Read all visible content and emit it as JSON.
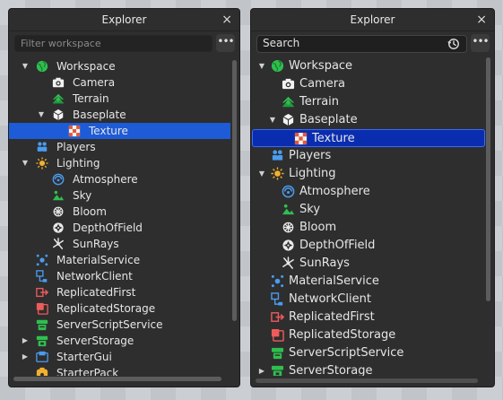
{
  "left_panel": {
    "title": "Explorer",
    "close_glyph": "×",
    "search_placeholder": "Filter workspace",
    "more_glyph": "•••",
    "items": [
      {
        "label": "Workspace",
        "icon": "workspace-globe-icon",
        "arrow": "▼",
        "depth": 0
      },
      {
        "label": "Camera",
        "icon": "camera-icon",
        "arrow": "",
        "depth": 1
      },
      {
        "label": "Terrain",
        "icon": "terrain-icon",
        "arrow": "",
        "depth": 1
      },
      {
        "label": "Baseplate",
        "icon": "part-cube-icon",
        "arrow": "▼",
        "depth": 1
      },
      {
        "label": "Texture",
        "icon": "texture-icon",
        "arrow": "",
        "depth": 2,
        "selected": true
      },
      {
        "label": "Players",
        "icon": "players-icon",
        "arrow": "",
        "depth": 0
      },
      {
        "label": "Lighting",
        "icon": "lighting-sun-icon",
        "arrow": "▼",
        "depth": 0
      },
      {
        "label": "Atmosphere",
        "icon": "atmosphere-icon",
        "arrow": "",
        "depth": 1
      },
      {
        "label": "Sky",
        "icon": "sky-icon",
        "arrow": "",
        "depth": 1
      },
      {
        "label": "Bloom",
        "icon": "bloom-icon",
        "arrow": "",
        "depth": 1
      },
      {
        "label": "DepthOfField",
        "icon": "depth-of-field-icon",
        "arrow": "",
        "depth": 1
      },
      {
        "label": "SunRays",
        "icon": "sunrays-icon",
        "arrow": "",
        "depth": 1
      },
      {
        "label": "MaterialService",
        "icon": "material-service-icon",
        "arrow": "",
        "depth": 0
      },
      {
        "label": "NetworkClient",
        "icon": "network-client-icon",
        "arrow": "",
        "depth": 0
      },
      {
        "label": "ReplicatedFirst",
        "icon": "replicated-first-icon",
        "arrow": "",
        "depth": 0
      },
      {
        "label": "ReplicatedStorage",
        "icon": "replicated-storage-icon",
        "arrow": "",
        "depth": 0
      },
      {
        "label": "ServerScriptService",
        "icon": "server-script-service-icon",
        "arrow": "",
        "depth": 0
      },
      {
        "label": "ServerStorage",
        "icon": "server-storage-icon",
        "arrow": "▶",
        "depth": 0
      },
      {
        "label": "StarterGui",
        "icon": "starter-gui-icon",
        "arrow": "▶",
        "depth": 0
      },
      {
        "label": "StarterPack",
        "icon": "starter-pack-icon",
        "arrow": "",
        "depth": 0
      }
    ]
  },
  "right_panel": {
    "title": "Explorer",
    "close_glyph": "×",
    "search_value": "Search",
    "history_icon": "history-icon",
    "more_glyph": "•••",
    "items": [
      {
        "label": "Workspace",
        "icon": "workspace-globe-icon",
        "arrow": "▼",
        "depth": 0
      },
      {
        "label": "Camera",
        "icon": "camera-icon",
        "arrow": "",
        "depth": 1
      },
      {
        "label": "Terrain",
        "icon": "terrain-icon",
        "arrow": "",
        "depth": 1
      },
      {
        "label": "Baseplate",
        "icon": "part-cube-icon",
        "arrow": "▼",
        "depth": 1
      },
      {
        "label": "Texture",
        "icon": "texture-icon",
        "arrow": "",
        "depth": 2,
        "selected": true
      },
      {
        "label": "Players",
        "icon": "players-icon",
        "arrow": "",
        "depth": 0
      },
      {
        "label": "Lighting",
        "icon": "lighting-sun-icon",
        "arrow": "▼",
        "depth": 0
      },
      {
        "label": "Atmosphere",
        "icon": "atmosphere-icon",
        "arrow": "",
        "depth": 1
      },
      {
        "label": "Sky",
        "icon": "sky-icon",
        "arrow": "",
        "depth": 1
      },
      {
        "label": "Bloom",
        "icon": "bloom-icon",
        "arrow": "",
        "depth": 1
      },
      {
        "label": "DepthOfField",
        "icon": "depth-of-field-icon",
        "arrow": "",
        "depth": 1
      },
      {
        "label": "SunRays",
        "icon": "sunrays-icon",
        "arrow": "",
        "depth": 1
      },
      {
        "label": "MaterialService",
        "icon": "material-service-icon",
        "arrow": "",
        "depth": 0
      },
      {
        "label": "NetworkClient",
        "icon": "network-client-icon",
        "arrow": "",
        "depth": 0
      },
      {
        "label": "ReplicatedFirst",
        "icon": "replicated-first-icon",
        "arrow": "",
        "depth": 0
      },
      {
        "label": "ReplicatedStorage",
        "icon": "replicated-storage-icon",
        "arrow": "",
        "depth": 0
      },
      {
        "label": "ServerScriptService",
        "icon": "server-script-service-icon",
        "arrow": "",
        "depth": 0
      },
      {
        "label": "ServerStorage",
        "icon": "server-storage-icon",
        "arrow": "▶",
        "depth": 0
      }
    ]
  },
  "colors": {
    "panel_bg": "#2e2e2e",
    "selection_left": "#1e5bd6",
    "selection_right": "#0a2db0",
    "selection_right_border": "#3b6aff"
  }
}
